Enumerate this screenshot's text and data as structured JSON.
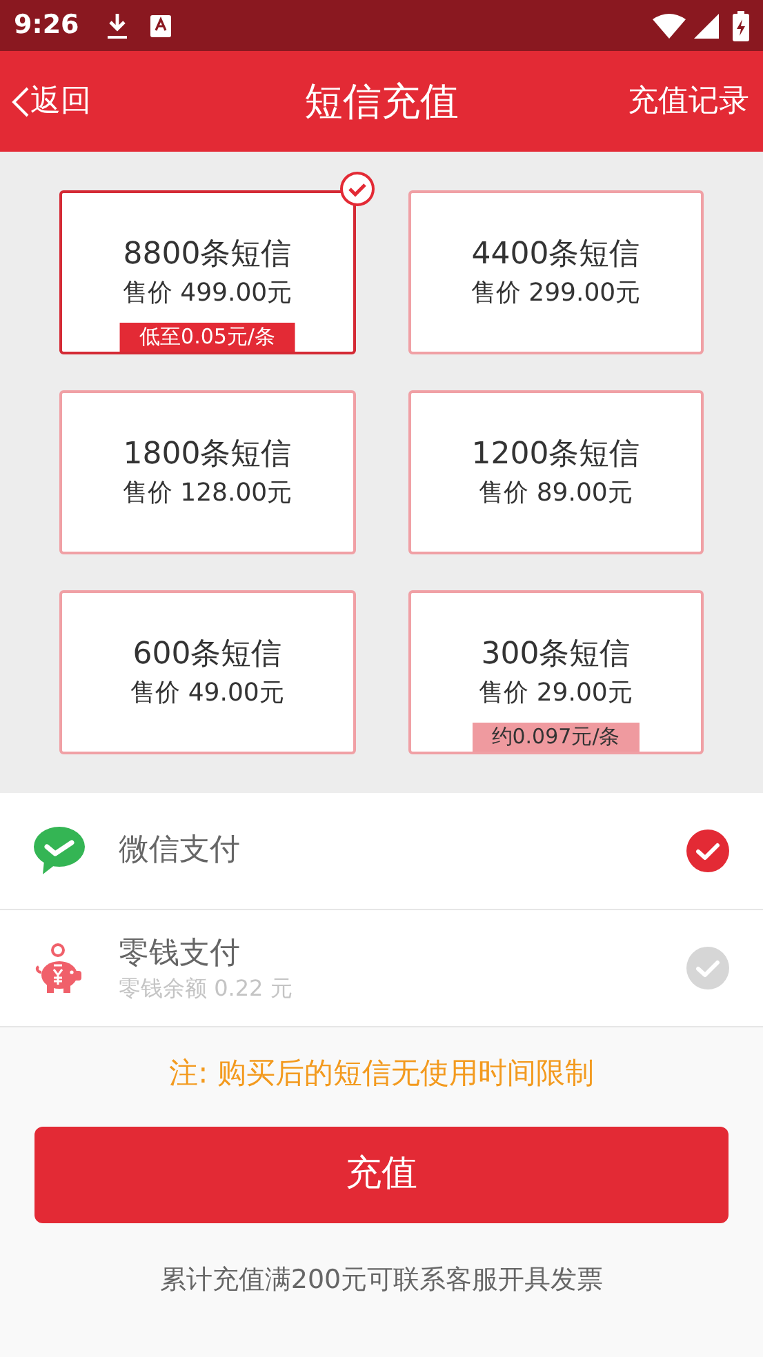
{
  "status_bar": {
    "time": "9:26"
  },
  "header": {
    "back": "返回",
    "title": "短信充值",
    "action": "充值记录"
  },
  "packages": [
    {
      "title": "8800条短信",
      "price": "售价 499.00元",
      "badge": "低至0.05元/条",
      "selected": true
    },
    {
      "title": "4400条短信",
      "price": "售价 299.00元",
      "selected": false
    },
    {
      "title": "1800条短信",
      "price": "售价 128.00元",
      "selected": false
    },
    {
      "title": "1200条短信",
      "price": "售价 89.00元",
      "selected": false
    },
    {
      "title": "600条短信",
      "price": "售价 49.00元",
      "selected": false
    },
    {
      "title": "300条短信",
      "price": "售价 29.00元",
      "badge": "约0.097元/条",
      "selected": false
    }
  ],
  "payment_methods": [
    {
      "kind": "wechat",
      "label": "微信支付",
      "selected": true
    },
    {
      "kind": "wallet",
      "label": "零钱支付",
      "sublabel": "零钱余额 0.22 元",
      "selected": false
    }
  ],
  "note": "注: 购买后的短信无使用时间限制",
  "submit": "充值",
  "footer": "累计充值满200元可联系客服开具发票"
}
